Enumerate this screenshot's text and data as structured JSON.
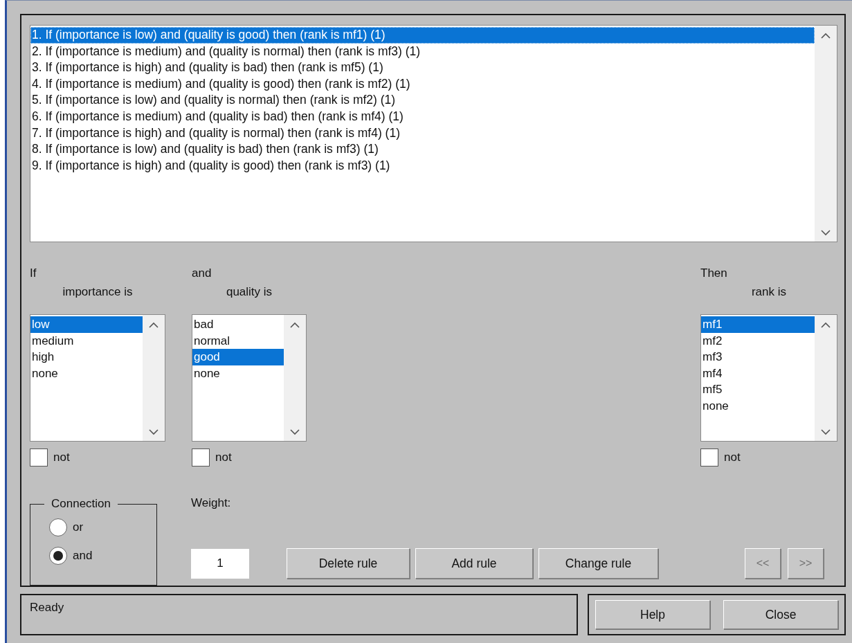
{
  "rules": [
    {
      "text": "1. If (importance is low) and (quality is good) then (rank is mf1) (1)",
      "selected": true
    },
    {
      "text": "2. If (importance is medium) and (quality is normal) then (rank is mf3) (1)",
      "selected": false
    },
    {
      "text": "3. If (importance is high) and (quality is bad) then (rank is mf5) (1)",
      "selected": false
    },
    {
      "text": "4. If (importance is medium) and (quality is good) then (rank is mf2) (1)",
      "selected": false
    },
    {
      "text": "5. If (importance is low) and (quality is normal) then (rank is mf2) (1)",
      "selected": false
    },
    {
      "text": "6. If (importance is medium) and (quality is bad) then (rank is mf4) (1)",
      "selected": false
    },
    {
      "text": "7. If (importance is high) and (quality is normal) then (rank is mf4) (1)",
      "selected": false
    },
    {
      "text": "8. If (importance is low) and (quality is bad) then (rank is mf3) (1)",
      "selected": false
    },
    {
      "text": "9. If (importance is high) and (quality is good) then (rank is mf3) (1)",
      "selected": false
    }
  ],
  "variables": [
    {
      "kind": "antecedent",
      "connector": "If",
      "variable": "importance is",
      "options": [
        {
          "label": "low",
          "selected": true
        },
        {
          "label": "medium",
          "selected": false
        },
        {
          "label": "high",
          "selected": false
        },
        {
          "label": "none",
          "selected": false
        }
      ],
      "not_label": "not",
      "not_checked": false
    },
    {
      "kind": "antecedent",
      "connector": "and",
      "variable": "quality is",
      "options": [
        {
          "label": "bad",
          "selected": false
        },
        {
          "label": "normal",
          "selected": false
        },
        {
          "label": "good",
          "selected": true
        },
        {
          "label": "none",
          "selected": false
        }
      ],
      "not_label": "not",
      "not_checked": false
    },
    {
      "kind": "consequent",
      "connector": "Then",
      "variable": "rank is",
      "options": [
        {
          "label": "mf1",
          "selected": true
        },
        {
          "label": "mf2",
          "selected": false
        },
        {
          "label": "mf3",
          "selected": false
        },
        {
          "label": "mf4",
          "selected": false
        },
        {
          "label": "mf5",
          "selected": false
        },
        {
          "label": "none",
          "selected": false
        }
      ],
      "not_label": "not",
      "not_checked": false
    }
  ],
  "connection": {
    "title": "Connection",
    "options": [
      {
        "label": "or",
        "selected": false
      },
      {
        "label": "and",
        "selected": true
      }
    ]
  },
  "weight": {
    "label": "Weight:",
    "value": "1"
  },
  "actions": [
    {
      "label": "Delete rule",
      "disabled": false
    },
    {
      "label": "Add rule",
      "disabled": false
    },
    {
      "label": "Change rule",
      "disabled": false
    }
  ],
  "nav": [
    {
      "label": "<<",
      "disabled": true
    },
    {
      "label": ">>",
      "disabled": true
    }
  ],
  "status": "Ready",
  "dialog_buttons": [
    "Help",
    "Close"
  ]
}
